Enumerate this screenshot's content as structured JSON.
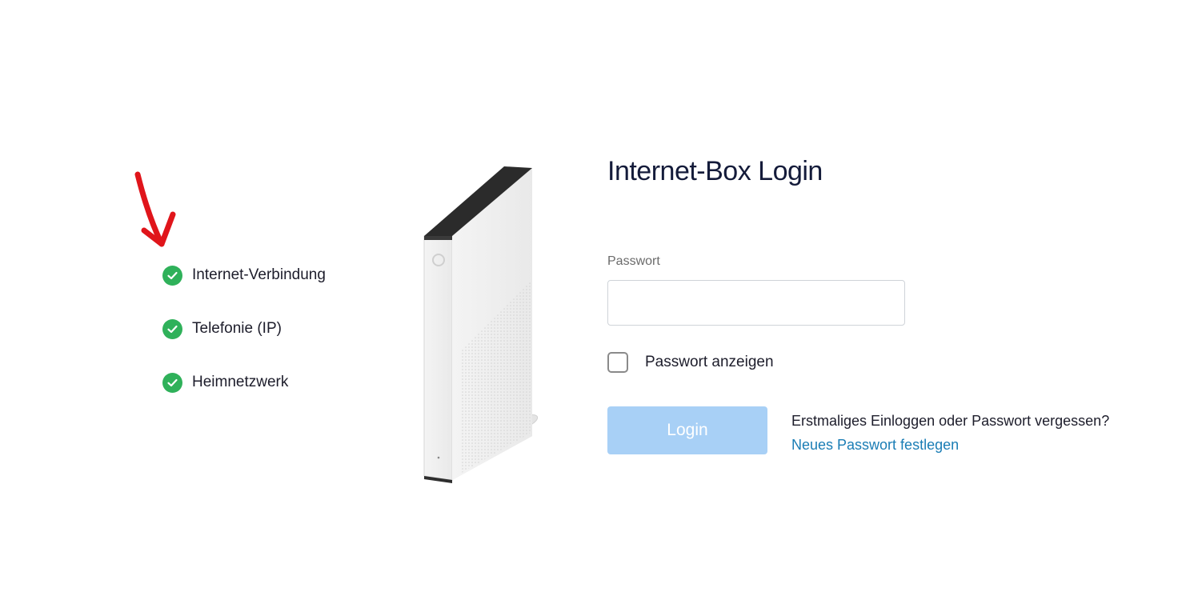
{
  "status_list": {
    "items": [
      {
        "label": "Internet-Verbindung",
        "status": "ok"
      },
      {
        "label": "Telefonie (IP)",
        "status": "ok"
      },
      {
        "label": "Heimnetzwerk",
        "status": "ok"
      }
    ],
    "icon": "check-circle-icon",
    "status_color": "#2fb15a"
  },
  "annotation": {
    "icon": "red-arrow-down-icon",
    "color": "#e0151b"
  },
  "login": {
    "title": "Internet-Box Login",
    "password_label": "Passwort",
    "password_value": "",
    "password_placeholder": "",
    "show_password_label": "Passwort anzeigen",
    "show_password_checked": false,
    "login_button_label": "Login",
    "login_button_color": "#a8d0f6",
    "help_text": "Erstmaliges Einloggen oder Passwort vergessen?",
    "help_link_label": "Neues Passwort festlegen",
    "link_color": "#1a7db5"
  }
}
